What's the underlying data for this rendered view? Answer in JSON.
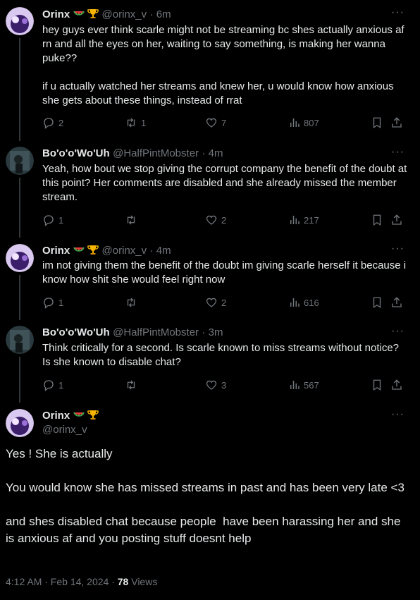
{
  "tweets": [
    {
      "name": "Orinx",
      "handle": "@orinx_v",
      "time": "· 6m",
      "text": "hey guys ever think scarle might not be streaming bc shes actually anxious af rn and all the eyes on her, waiting to say something, is making her wanna puke??\n\nif u actually watched her streams and knew her, u would know how anxious she gets about these things, instead of rrat",
      "replies": "2",
      "retweets": "1",
      "likes": "7",
      "views": "807"
    },
    {
      "name": "Bo'o'o'Wo'Uh",
      "handle": "@HalfPintMobster",
      "time": "· 4m",
      "text": "Yeah, how bout we stop giving the corrupt company the benefit of the doubt at this point? Her comments are disabled and she already missed the member stream.",
      "replies": "1",
      "retweets": "",
      "likes": "2",
      "views": "217"
    },
    {
      "name": "Orinx",
      "handle": "@orinx_v",
      "time": "· 4m",
      "text": "im not giving them the benefit of the doubt im giving scarle herself it because i know how shit she would feel right now",
      "replies": "1",
      "retweets": "",
      "likes": "2",
      "views": "616"
    },
    {
      "name": "Bo'o'o'Wo'Uh",
      "handle": "@HalfPintMobster",
      "time": "· 3m",
      "text": "Think critically for a second. Is scarle known to miss streams without notice? Is she known to disable chat?",
      "replies": "1",
      "retweets": "",
      "likes": "3",
      "views": "567"
    }
  ],
  "main_tweet": {
    "name": "Orinx",
    "handle": "@orinx_v",
    "text": "Yes ! She is actually\n\nYou would know she has missed streams in past and has been very late <3\n\nand shes disabled chat because people  have been harassing her and she is anxious af and you posting stuff doesnt help",
    "timestamp": "4:12 AM · Feb 14, 2024 · ",
    "views_count": "78",
    "views_label": " Views"
  },
  "icons": {
    "more": "more-icon",
    "reply": "reply-icon",
    "retweet": "retweet-icon",
    "like": "heart-icon",
    "views": "views-icon",
    "bookmark": "bookmark-icon",
    "share": "share-icon",
    "watermelon": "watermelon-emoji",
    "trophy": "trophy-emoji"
  },
  "colors": {
    "background": "#000000",
    "text": "#e7e9ea",
    "secondary": "#71767b",
    "thread_line": "#333639"
  }
}
